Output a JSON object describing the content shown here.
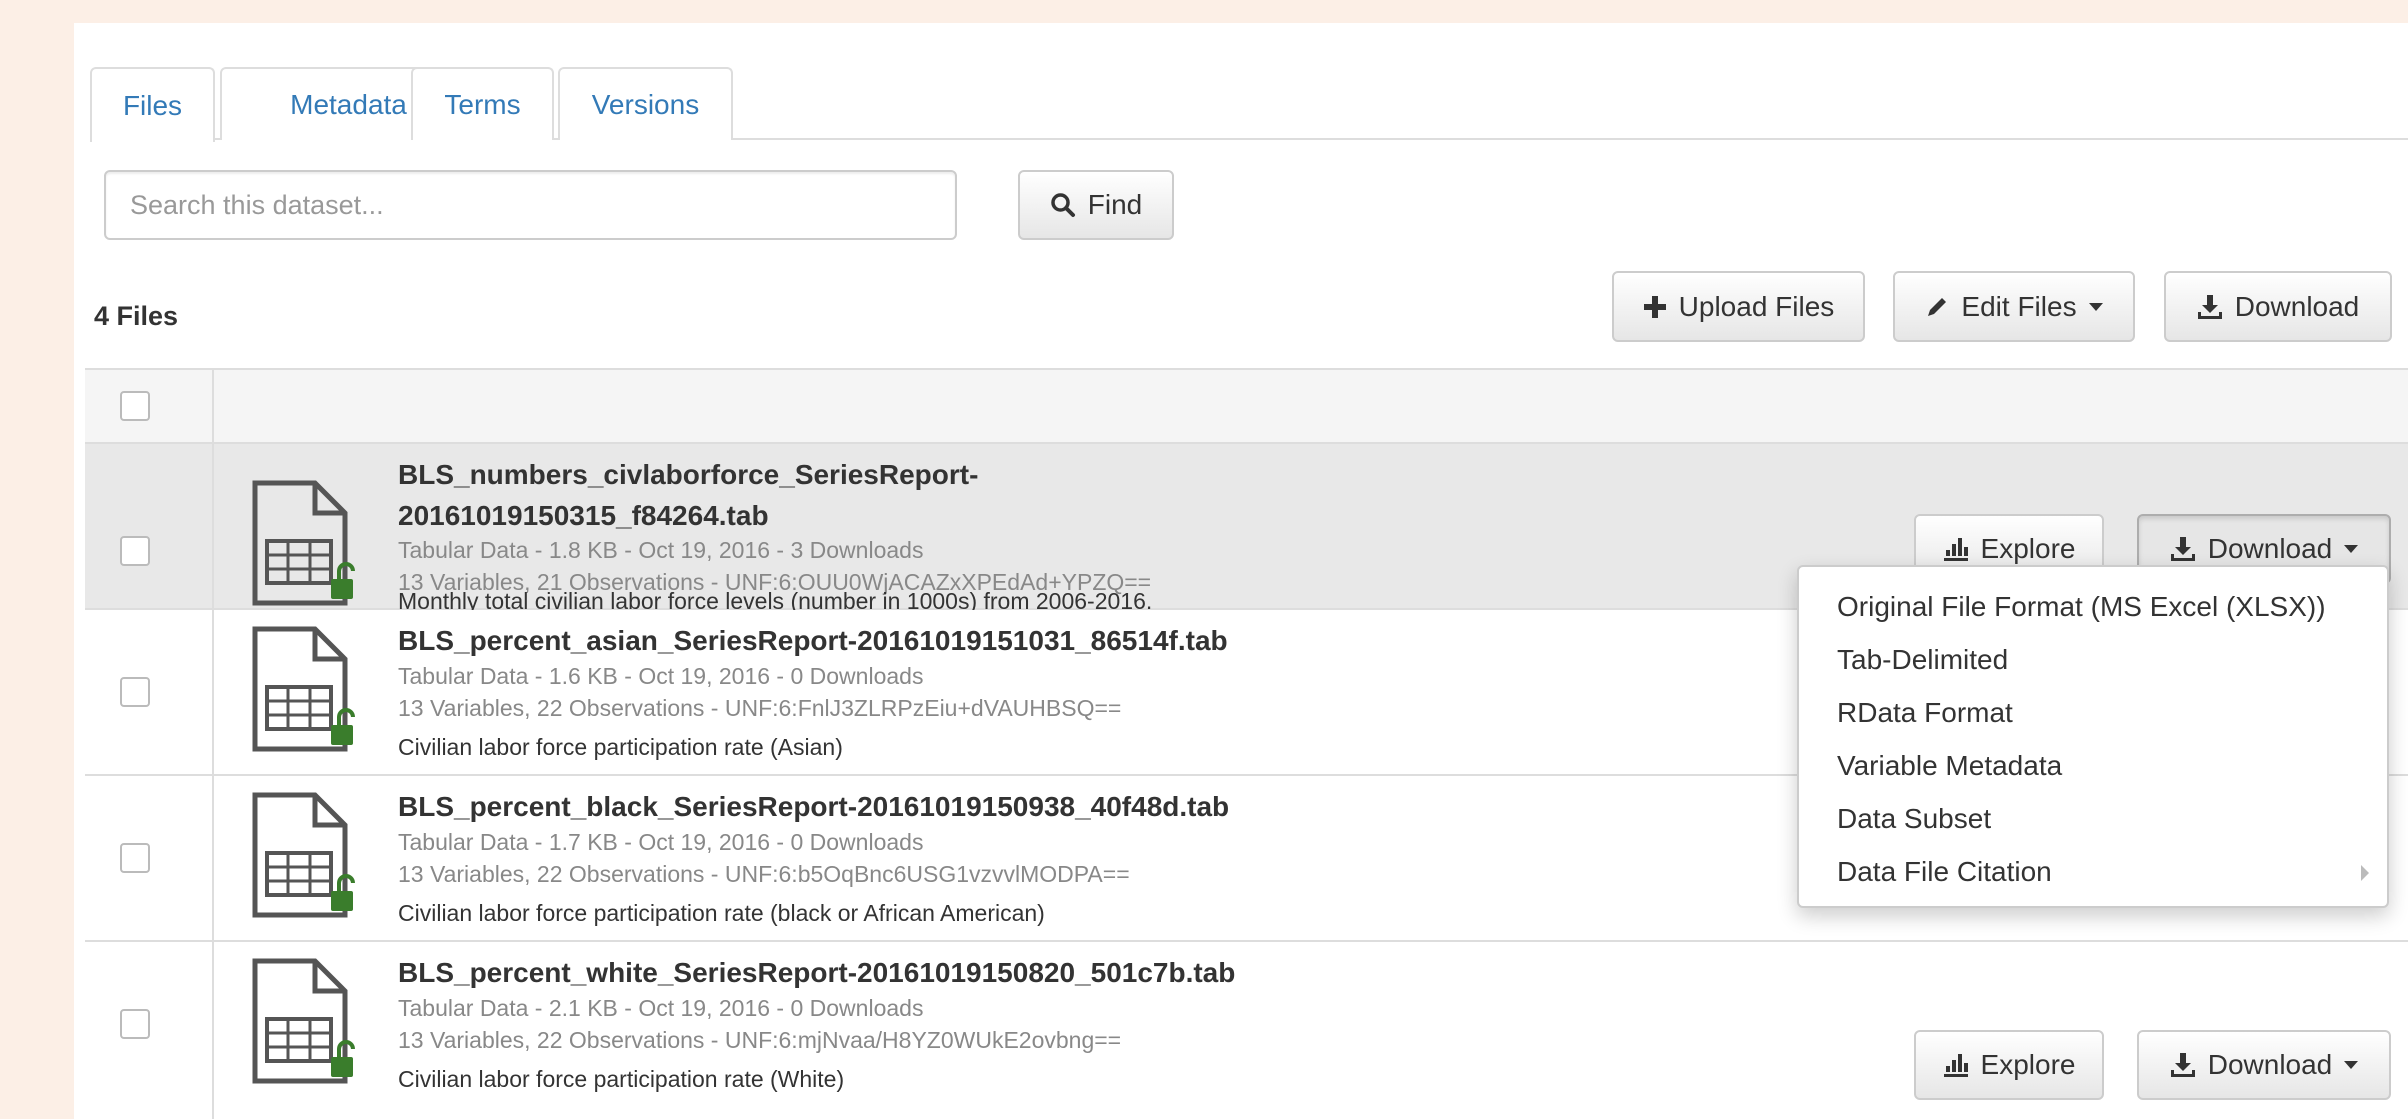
{
  "tabs": [
    {
      "label": "Files",
      "active": true
    },
    {
      "label": "Metadata",
      "active": false
    },
    {
      "label": "Terms",
      "active": false
    },
    {
      "label": "Versions",
      "active": false
    }
  ],
  "search": {
    "placeholder": "Search this dataset...",
    "find_label": "Find"
  },
  "files_count": "4 Files",
  "toolbar": {
    "upload_label": "Upload Files",
    "edit_label": "Edit Files",
    "download_label": "Download"
  },
  "files": [
    {
      "name_line1": "BLS_numbers_civlaborforce_SeriesReport-",
      "name_line2": "20161019150315_f84264.tab",
      "meta1": "Tabular Data - 1.8 KB - Oct 19, 2016 - 3 Downloads",
      "meta2": "13 Variables, 21 Observations - UNF:6:OUU0WjACAZxXPEdAd+YPZQ==",
      "description": "Monthly total civilian labor force levels (number in 1000s) from 2006-2016.",
      "explore_label": "Explore",
      "download_label": "Download"
    },
    {
      "name": "BLS_percent_asian_SeriesReport-20161019151031_86514f.tab",
      "meta1": "Tabular Data - 1.6 KB - Oct 19, 2016 - 0 Downloads",
      "meta2": "13 Variables, 22 Observations - UNF:6:FnlJ3ZLRPzEiu+dVAUHBSQ==",
      "description": "Civilian labor force participation rate (Asian)"
    },
    {
      "name": "BLS_percent_black_SeriesReport-20161019150938_40f48d.tab",
      "meta1": "Tabular Data - 1.7 KB - Oct 19, 2016 - 0 Downloads",
      "meta2": "13 Variables, 22 Observations - UNF:6:b5OqBnc6USG1vzvvlMODPA==",
      "description": "Civilian labor force participation rate (black or African American)"
    },
    {
      "name": "BLS_percent_white_SeriesReport-20161019150820_501c7b.tab",
      "meta1": "Tabular Data - 2.1 KB - Oct 19, 2016 - 0 Downloads",
      "meta2": "13 Variables, 22 Observations - UNF:6:mjNvaa/H8YZ0WUkE2ovbng==",
      "description": "Civilian labor force participation rate (White)",
      "explore_label": "Explore",
      "download_label": "Download"
    }
  ],
  "download_menu": [
    "Original File Format (MS Excel (XLSX))",
    "Tab-Delimited",
    "RData Format",
    "Variable Metadata",
    "Data Subset",
    "Data File Citation"
  ],
  "colors": {
    "link": "#337ab7",
    "lock": "#3a7d2c",
    "border": "#dddddd"
  }
}
